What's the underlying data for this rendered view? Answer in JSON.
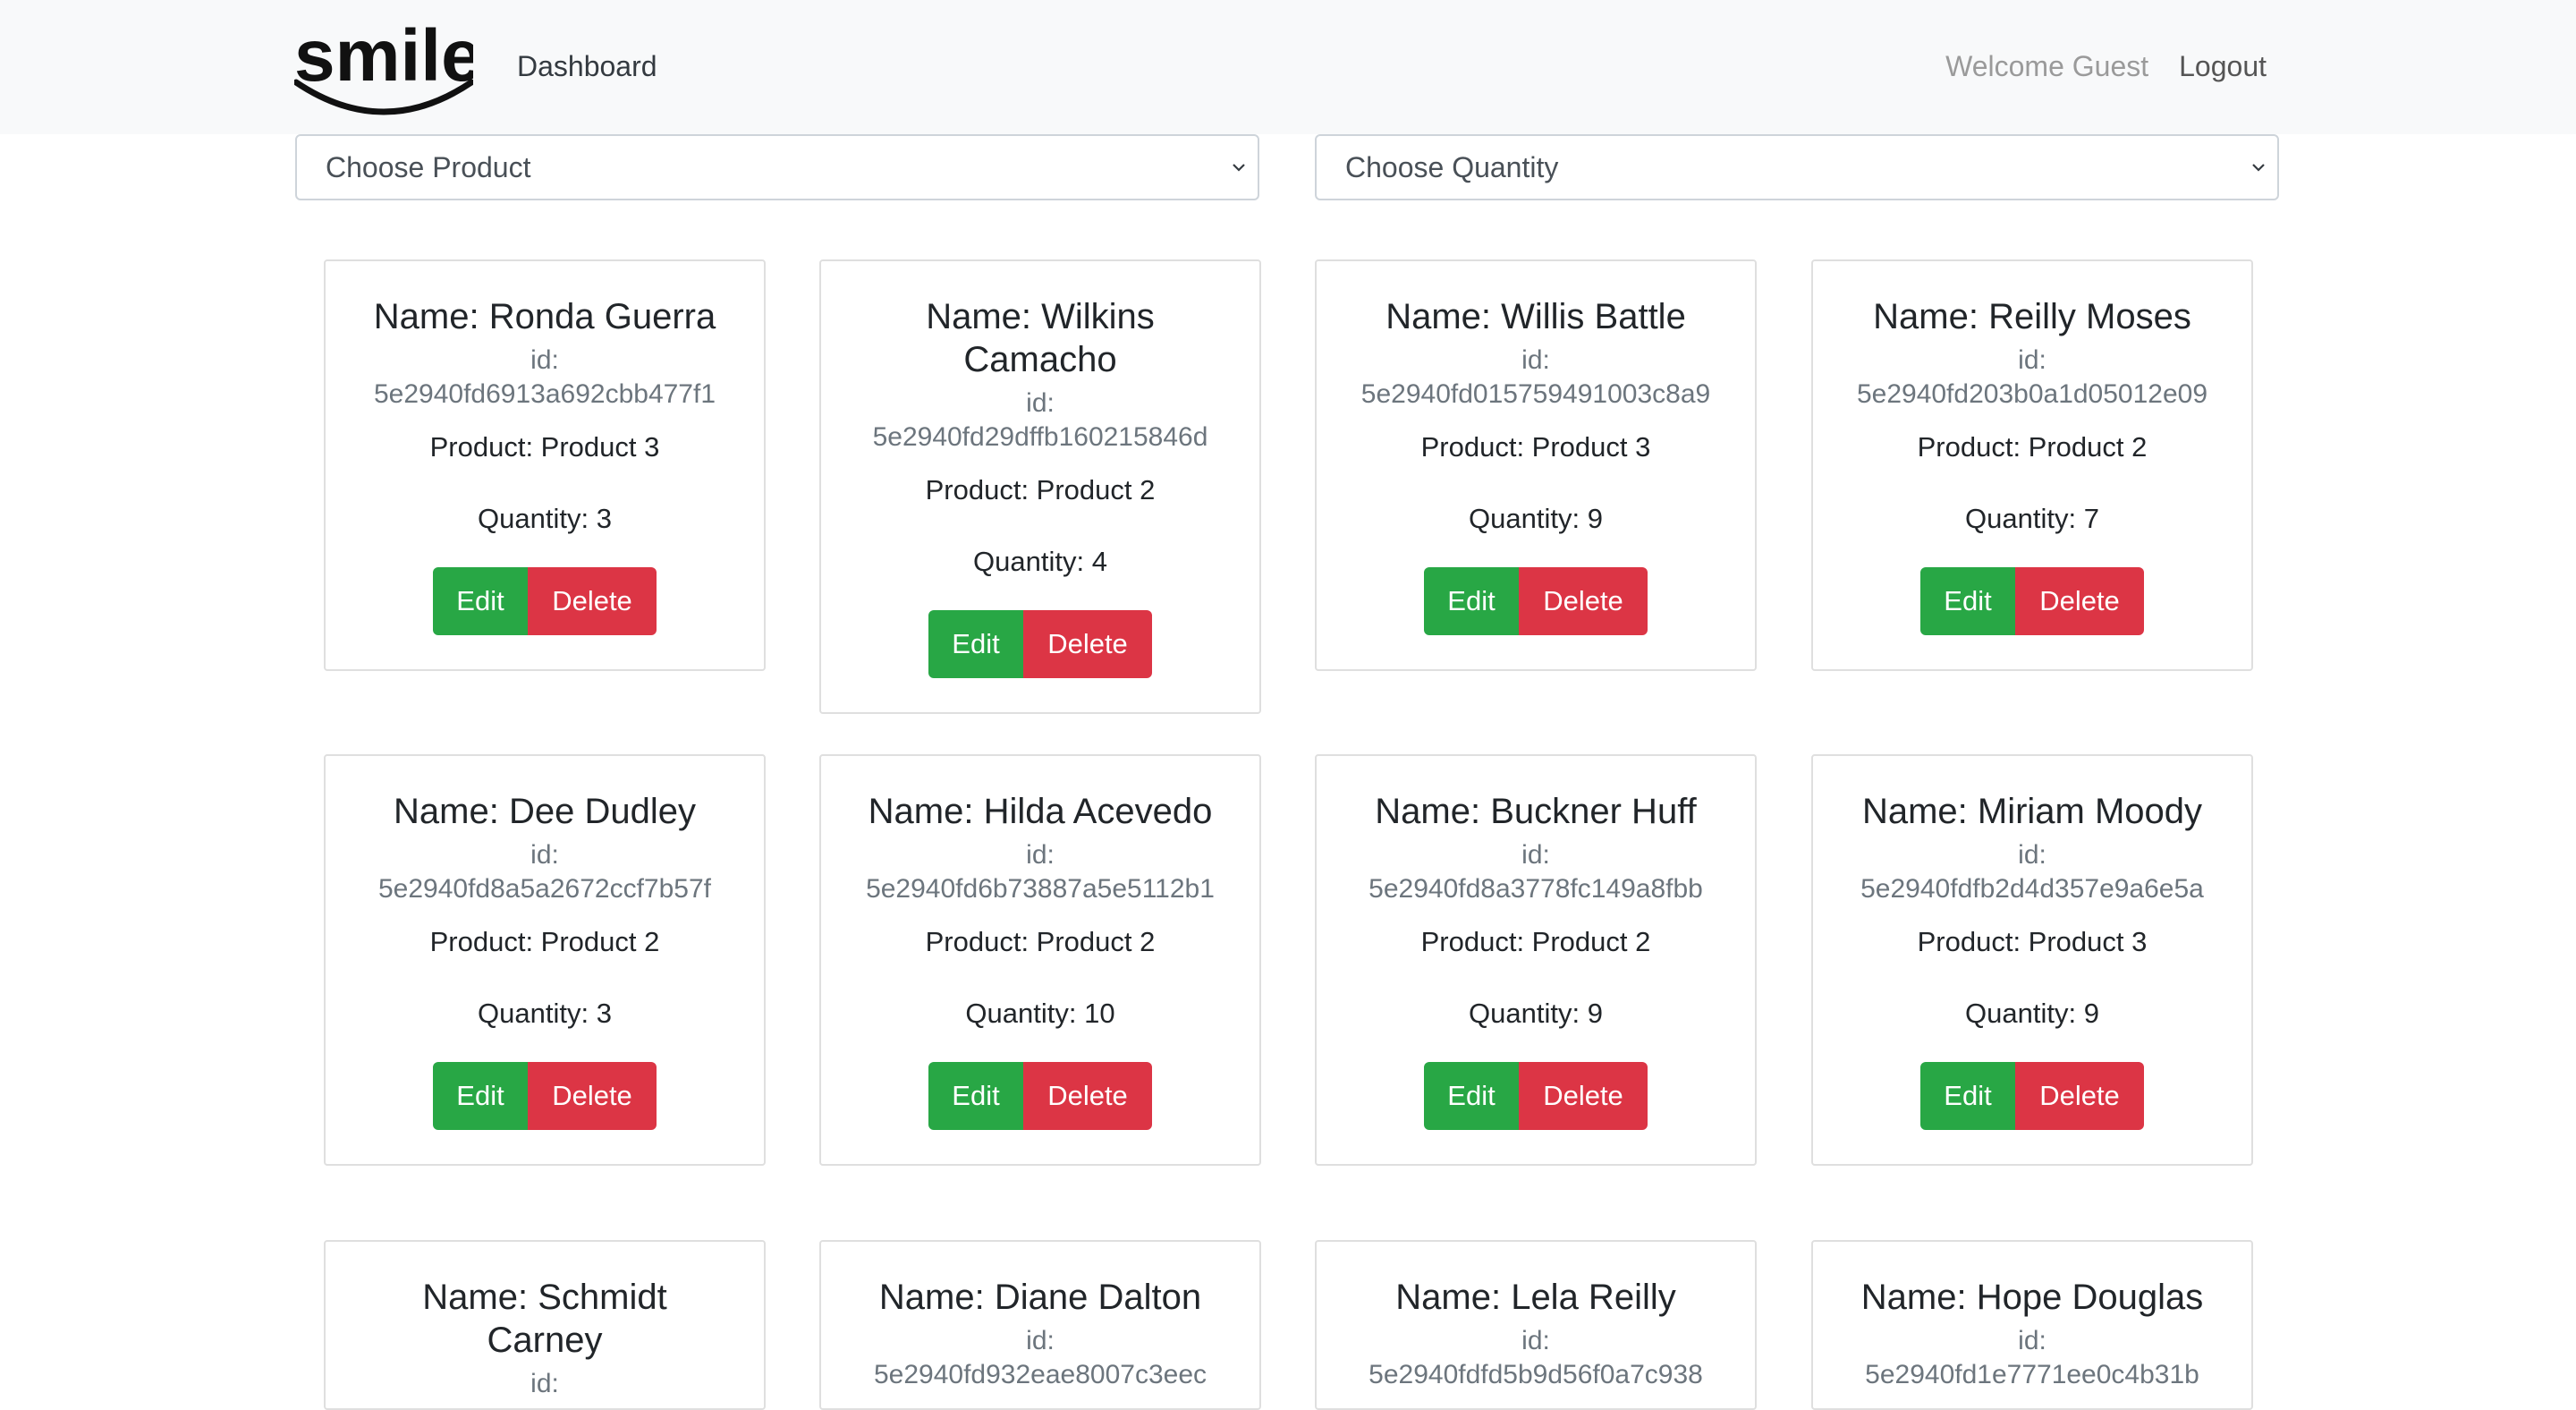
{
  "navbar": {
    "brand": "smile",
    "dashboard_label": "Dashboard",
    "welcome_text": "Welcome Guest",
    "logout_label": "Logout"
  },
  "filters": {
    "product_select": "Choose Product",
    "quantity_select": "Choose Quantity"
  },
  "cards": [
    {
      "name": "Name: Ronda Guerra",
      "id_label": "id:",
      "id": "5e2940fd6913a692cbb477f1",
      "product": "Product: Product 3",
      "quantity": "Quantity: 3",
      "edit": "Edit",
      "delete": "Delete"
    },
    {
      "name": "Name: Wilkins Camacho",
      "id_label": "id:",
      "id": "5e2940fd29dffb160215846d",
      "product": "Product: Product 2",
      "quantity": "Quantity: 4",
      "edit": "Edit",
      "delete": "Delete"
    },
    {
      "name": "Name: Willis Battle",
      "id_label": "id:",
      "id": "5e2940fd015759491003c8a9",
      "product": "Product: Product 3",
      "quantity": "Quantity: 9",
      "edit": "Edit",
      "delete": "Delete"
    },
    {
      "name": "Name: Reilly Moses",
      "id_label": "id:",
      "id": "5e2940fd203b0a1d05012e09",
      "product": "Product: Product 2",
      "quantity": "Quantity: 7",
      "edit": "Edit",
      "delete": "Delete"
    },
    {
      "name": "Name: Dee Dudley",
      "id_label": "id:",
      "id": "5e2940fd8a5a2672ccf7b57f",
      "product": "Product: Product 2",
      "quantity": "Quantity: 3",
      "edit": "Edit",
      "delete": "Delete"
    },
    {
      "name": "Name: Hilda Acevedo",
      "id_label": "id:",
      "id": "5e2940fd6b73887a5e5112b1",
      "product": "Product: Product 2",
      "quantity": "Quantity: 10",
      "edit": "Edit",
      "delete": "Delete"
    },
    {
      "name": "Name: Buckner Huff",
      "id_label": "id:",
      "id": "5e2940fd8a3778fc149a8fbb",
      "product": "Product: Product 2",
      "quantity": "Quantity: 9",
      "edit": "Edit",
      "delete": "Delete"
    },
    {
      "name": "Name: Miriam Moody",
      "id_label": "id:",
      "id": "5e2940fdfb2d4d357e9a6e5a",
      "product": "Product: Product 3",
      "quantity": "Quantity: 9",
      "edit": "Edit",
      "delete": "Delete"
    },
    {
      "name": "Name: Schmidt Carney",
      "id_label": "id:",
      "id": "",
      "product": "",
      "quantity": "",
      "edit": "",
      "delete": ""
    },
    {
      "name": "Name: Diane Dalton",
      "id_label": "id:",
      "id": "5e2940fd932eae8007c3eec",
      "product": "",
      "quantity": "",
      "edit": "",
      "delete": ""
    },
    {
      "name": "Name: Lela Reilly",
      "id_label": "id:",
      "id": "5e2940fdfd5b9d56f0a7c938",
      "product": "",
      "quantity": "",
      "edit": "",
      "delete": ""
    },
    {
      "name": "Name: Hope Douglas",
      "id_label": "id:",
      "id": "5e2940fd1e7771ee0c4b31b",
      "product": "",
      "quantity": "",
      "edit": "",
      "delete": ""
    }
  ],
  "colors": {
    "edit_button": "#28a745",
    "delete_button": "#dc3545",
    "navbar_bg": "#f8f9fa"
  }
}
